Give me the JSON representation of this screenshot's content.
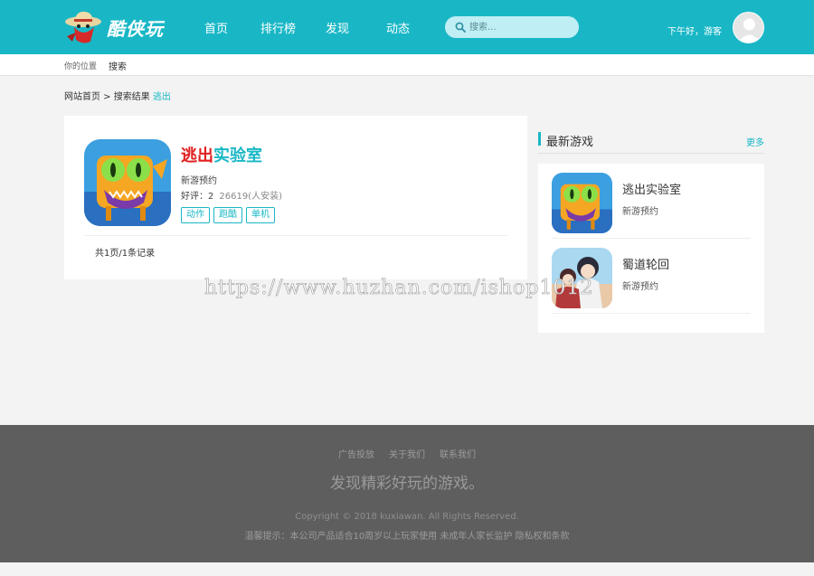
{
  "brand": {
    "logo_text": "酷侠玩"
  },
  "nav": [
    {
      "label": "首页"
    },
    {
      "label": "排行榜"
    },
    {
      "label": "发现"
    },
    {
      "label": "动态"
    }
  ],
  "search": {
    "placeholder": "搜索..."
  },
  "user": {
    "greeting": "下午好，游客"
  },
  "location": {
    "label": "你的位置",
    "value": "搜索"
  },
  "breadcrumb": {
    "home": "网站首页",
    "sep": " > ",
    "section": "搜索结果",
    "keyword": "逃出"
  },
  "result": {
    "title_highlight": "逃出",
    "title_rest": "实验室",
    "status": "新游预约",
    "rating_label": "好评：2",
    "installs": "26619(人安装)",
    "tags": [
      "动作",
      "跑酷",
      "单机"
    ],
    "pager": "共1页/1条记录"
  },
  "sidebar": {
    "title": "最新游戏",
    "more": "更多",
    "items": [
      {
        "name": "逃出实验室",
        "status": "新游预约"
      },
      {
        "name": "蜀道轮回",
        "status": "新游预约"
      }
    ]
  },
  "watermark": "https://www.huzhan.com/ishop1012",
  "footer": {
    "links": [
      "广告投放",
      "关于我们",
      "联系我们"
    ],
    "slogan": "发现精彩好玩的游戏。",
    "copyright": "Copyright © 2018 kuxiawan. All Rights Reserved.",
    "notice": "温馨提示：本公司产品适合10周岁以上玩家使用 未成年人家长监护 隐私权和条款"
  },
  "colors": {
    "brand": "#19b7c6",
    "highlight": "#e02020",
    "footer_bg": "#5e5e5e"
  }
}
